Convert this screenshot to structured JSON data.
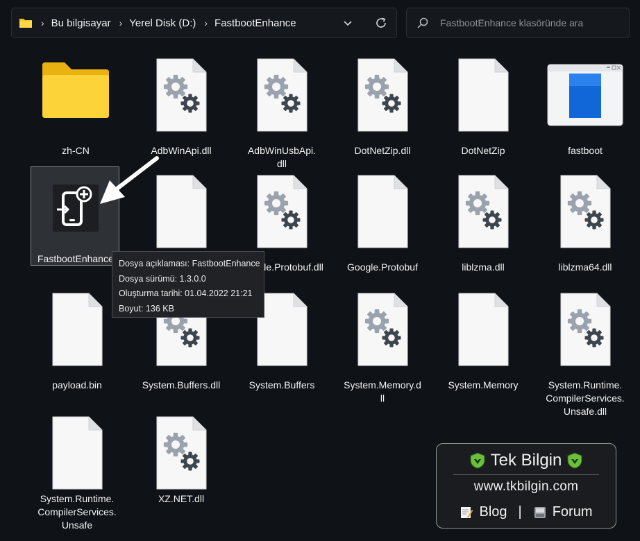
{
  "breadcrumb": {
    "items": [
      "Bu bilgisayar",
      "Yerel Disk (D:)",
      "FastbootEnhance"
    ]
  },
  "search": {
    "placeholder": "FastbootEnhance klasöründe ara"
  },
  "files": [
    {
      "label": "zh-CN",
      "icon": "folder-icon"
    },
    {
      "label": "AdbWinApi.dll",
      "icon": "dll-file-icon"
    },
    {
      "label": "AdbWinUsbApi.dll",
      "icon": "dll-file-icon"
    },
    {
      "label": "DotNetZip.dll",
      "icon": "dll-file-icon"
    },
    {
      "label": "DotNetZip",
      "icon": "blank-file-icon"
    },
    {
      "label": "fastboot",
      "icon": "exe-file-icon"
    },
    {
      "label": "FastbootEnhance",
      "icon": "app-icon"
    },
    {
      "label": "",
      "icon": "blank-file-icon"
    },
    {
      "label": "Google.Protobuf.dll",
      "icon": "dll-file-icon"
    },
    {
      "label": "Google.Protobuf",
      "icon": "blank-file-icon"
    },
    {
      "label": "liblzma.dll",
      "icon": "dll-file-icon"
    },
    {
      "label": "liblzma64.dll",
      "icon": "dll-file-icon"
    },
    {
      "label": "payload.bin",
      "icon": "blank-file-icon"
    },
    {
      "label": "System.Buffers.dll",
      "icon": "dll-file-icon"
    },
    {
      "label": "System.Buffers",
      "icon": "blank-file-icon"
    },
    {
      "label": "System.Memory.dll",
      "icon": "dll-file-icon"
    },
    {
      "label": "System.Memory",
      "icon": "blank-file-icon"
    },
    {
      "label": "System.Runtime.CompilerServices.Unsafe.dll",
      "icon": "dll-file-icon"
    },
    {
      "label": "System.Runtime.CompilerServices.Unsafe",
      "icon": "blank-file-icon"
    },
    {
      "label": "XZ.NET.dll",
      "icon": "dll-file-icon"
    }
  ],
  "tooltip": {
    "description": "Dosya açıklaması: FastbootEnhance",
    "version": "Dosya sürümü: 1.3.0.0",
    "created": "Oluşturma tarihi: 01.04.2022 21:21",
    "size": "Boyut: 136 KB"
  },
  "watermark": {
    "title": "Tek Bilgin",
    "url": "www.tkbilgin.com",
    "blog": "Blog",
    "separator": "|",
    "forum": "Forum"
  },
  "colors": {
    "background": "#0f1216",
    "folder": "#f5c518",
    "shield": "#6bbf3a"
  }
}
